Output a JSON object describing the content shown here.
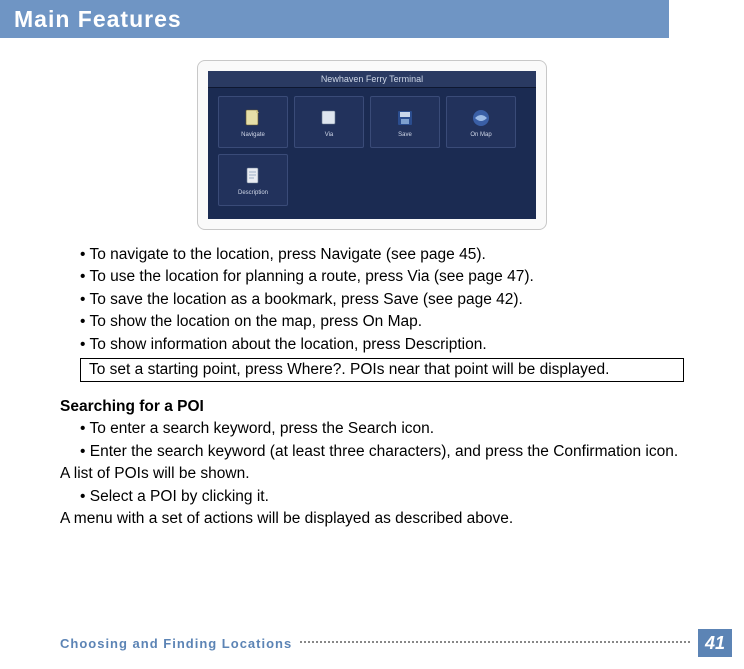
{
  "header": {
    "title": "Main Features"
  },
  "device": {
    "title": "Newhaven Ferry Terminal",
    "tiles": [
      {
        "label": "Navigate"
      },
      {
        "label": "Via"
      },
      {
        "label": "Save"
      },
      {
        "label": "On Map"
      },
      {
        "label": "Description"
      }
    ]
  },
  "action_bullets": [
    "• To navigate to the location, press Navigate (see page 45).",
    "• To use the location for planning a route, press Via (see page 47).",
    "• To save the location as a bookmark, press Save (see page 42).",
    "• To show the location on the map, press On Map.",
    "• To show information about the location, press Description."
  ],
  "boxed_note": "To set a starting point, press Where?. POIs near that point will be displayed.",
  "search": {
    "heading": "Searching for a POI",
    "bullets": [
      "• To enter a search keyword, press the Search icon.",
      "• Enter the search keyword (at least three characters), and press the Confirmation icon."
    ],
    "line1": "A list of POIs will be shown.",
    "bullet3": "• Select a POI by clicking it.",
    "line2": "A menu with a set of actions will be displayed as described above."
  },
  "footer": {
    "section": "Choosing and Finding Locations",
    "page_number": "41"
  }
}
